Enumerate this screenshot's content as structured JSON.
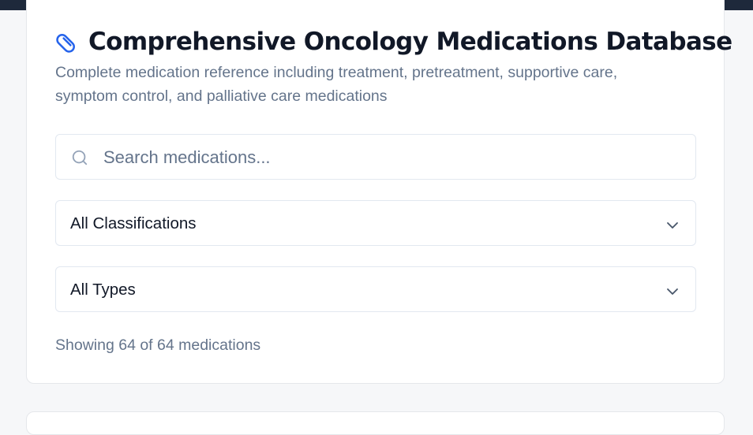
{
  "header": {
    "icon": "pill-icon",
    "title": "Comprehensive Oncology Medications Database",
    "subtitle": "Complete medication reference including treatment, pretreatment, supportive care, symptom control, and palliative care medications"
  },
  "search": {
    "icon": "search-icon",
    "placeholder": "Search medications...",
    "value": ""
  },
  "filters": {
    "classification": {
      "selected": "All Classifications",
      "icon": "chevron-down-icon"
    },
    "type": {
      "selected": "All Types",
      "icon": "chevron-down-icon"
    }
  },
  "results": {
    "count_text": "Showing 64 of 64 medications"
  },
  "colors": {
    "accent": "#2563eb",
    "topbar": "#1e293b",
    "muted_text": "#64748b",
    "border": "#e2e8f0"
  }
}
